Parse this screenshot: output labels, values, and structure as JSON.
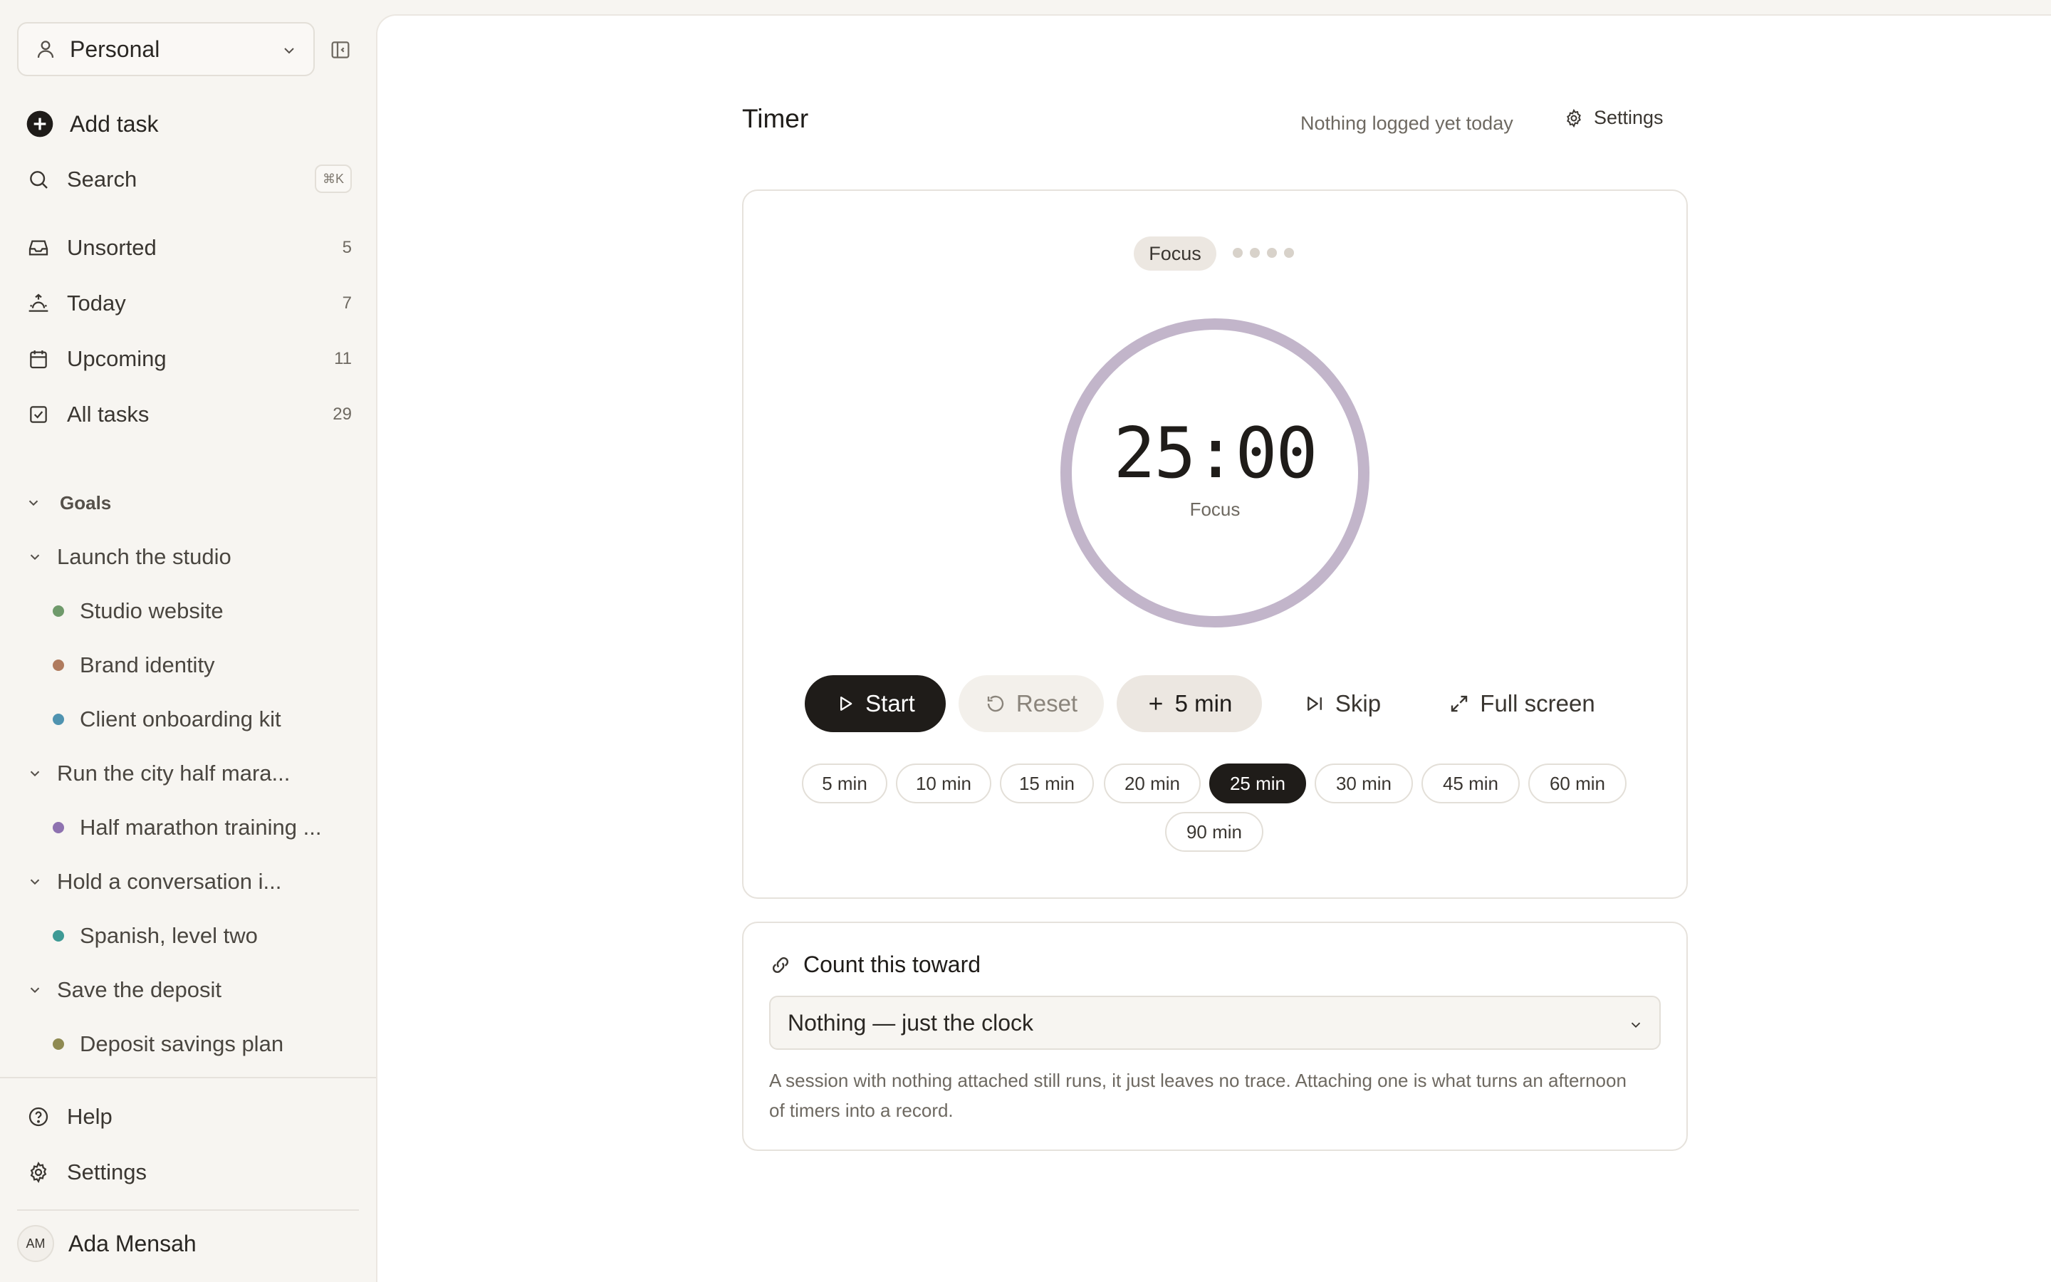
{
  "sidebar": {
    "workspace": {
      "label": "Personal"
    },
    "add_task": "Add task",
    "search": {
      "label": "Search",
      "shortcut": "⌘K"
    },
    "nav": [
      {
        "label": "Unsorted",
        "count": "5",
        "icon": "inbox-icon"
      },
      {
        "label": "Today",
        "count": "7",
        "icon": "sunrise-icon"
      },
      {
        "label": "Upcoming",
        "count": "11",
        "icon": "calendar-icon"
      },
      {
        "label": "All tasks",
        "count": "29",
        "icon": "checkbox-icon"
      }
    ],
    "goals_label": "Goals",
    "goals": [
      {
        "label": "Launch the studio",
        "projects": [
          {
            "label": "Studio website",
            "color": "#6f9a6b"
          },
          {
            "label": "Brand identity",
            "color": "#b07b5e"
          },
          {
            "label": "Client onboarding kit",
            "color": "#4f93b0"
          }
        ]
      },
      {
        "label": "Run the city half mara...",
        "projects": [
          {
            "label": "Half marathon training ...",
            "color": "#8e72b0"
          }
        ]
      },
      {
        "label": "Hold a conversation i...",
        "projects": [
          {
            "label": "Spanish, level two",
            "color": "#3e9a95"
          }
        ]
      },
      {
        "label": "Save the deposit",
        "projects": [
          {
            "label": "Deposit savings plan",
            "color": "#8f8a52"
          }
        ]
      }
    ],
    "help": "Help",
    "settings": "Settings",
    "user": {
      "initials": "AM",
      "name": "Ada Mensah"
    }
  },
  "main": {
    "title": "Timer",
    "logged_status": "Nothing logged yet today",
    "settings_label": "Settings",
    "timer": {
      "mode": "Focus",
      "sessions_total": 4,
      "time": "25:00",
      "sublabel": "Focus",
      "ring_color": "#c2b5ca",
      "progress": 0
    },
    "controls": {
      "start": "Start",
      "reset": "Reset",
      "add": "5 min",
      "skip": "Skip",
      "fullscreen": "Full screen"
    },
    "durations": [
      "5 min",
      "10 min",
      "15 min",
      "20 min",
      "25 min",
      "30 min",
      "45 min",
      "60 min",
      "90 min"
    ],
    "selected_duration": "25 min",
    "link": {
      "title": "Count this toward",
      "selected": "Nothing — just the clock",
      "hint": "A session with nothing attached still runs, it just leaves no trace. Attaching one is what turns an afternoon of timers into a record."
    }
  }
}
